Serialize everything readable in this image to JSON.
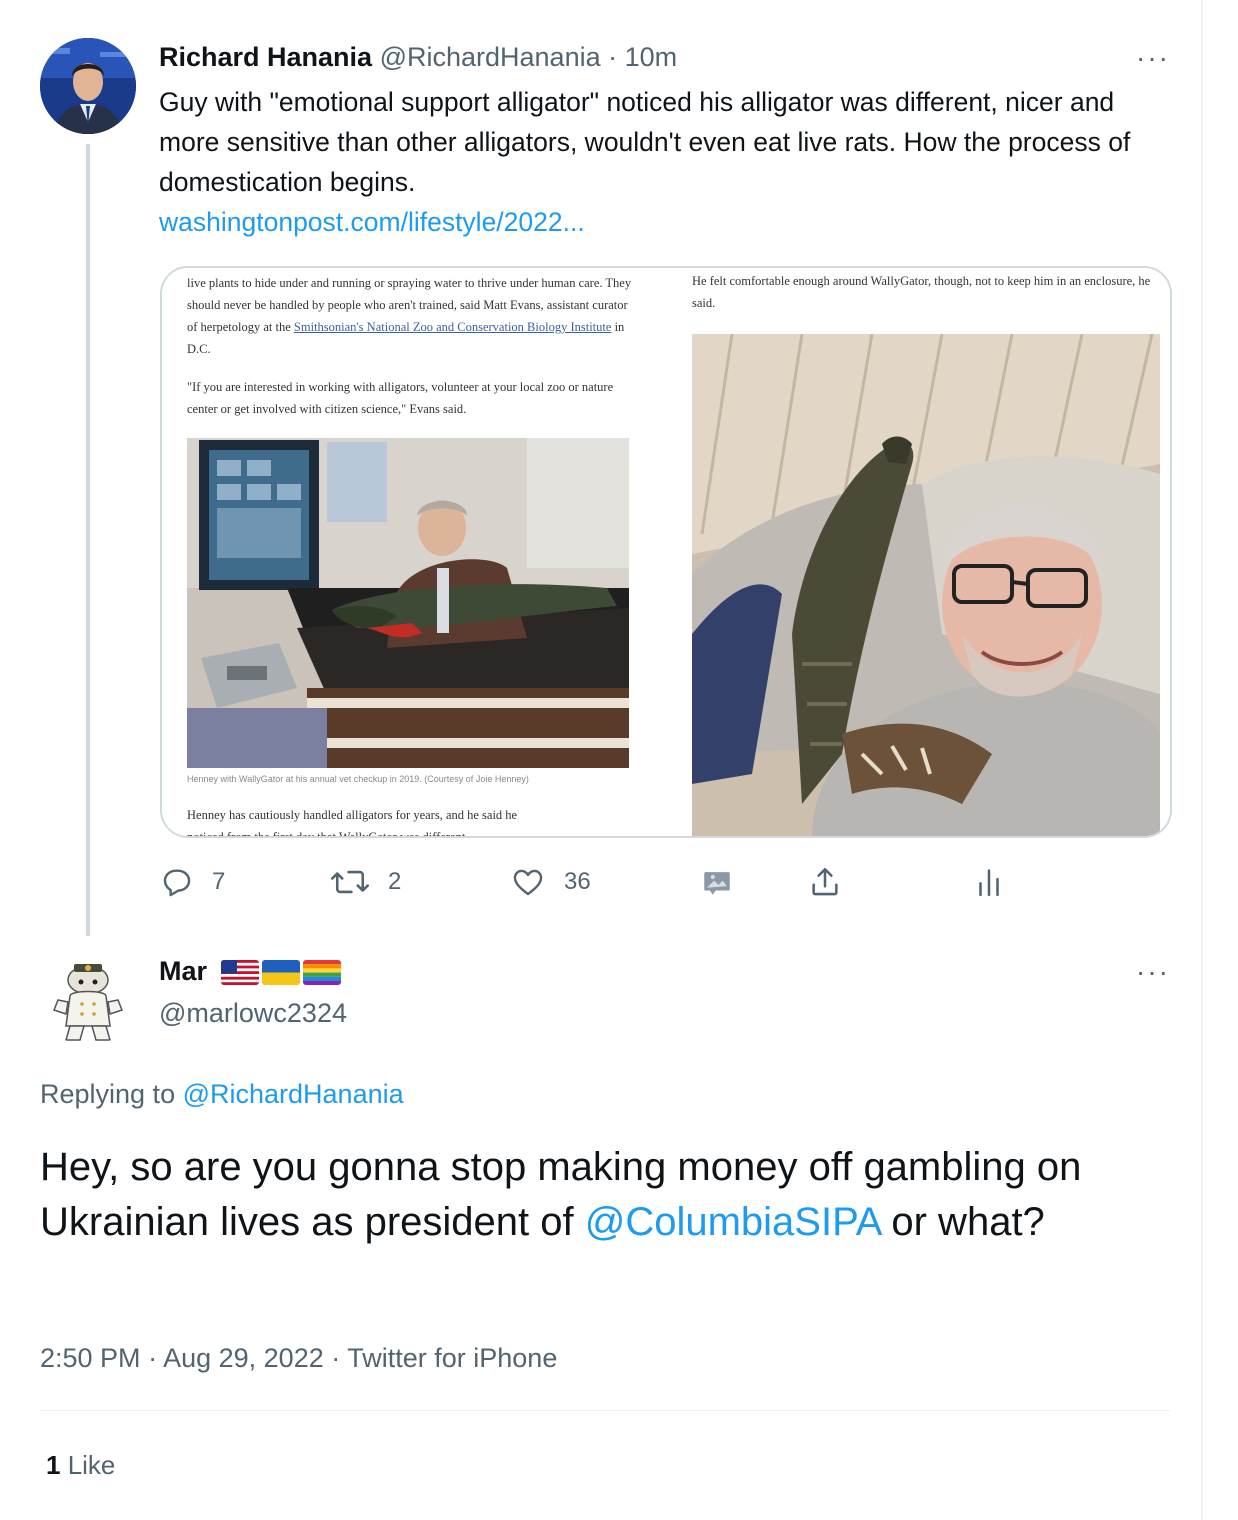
{
  "parent": {
    "name": "Richard Hanania",
    "handle": "@RichardHanania",
    "dot": "·",
    "time": "10m",
    "text": "Guy with \"emotional support alligator\" noticed his alligator was different, nicer and more sensitive than other alligators, wouldn't even eat live rats. How the process of domestication begins.",
    "link": "washingtonpost.com/lifestyle/2022...",
    "media": {
      "left_para1": "live plants to hide under and running or spraying water to thrive under human care. They should never be handled by people who aren't trained, said Matt Evans, assistant curator of herpetology at the",
      "left_para1_link": "Smithsonian's National Zoo and Conservation Biology Institute",
      "left_para1_end": " in D.C.",
      "left_para2": "\"If you are interested in working with alligators, volunteer at your local zoo or nature center or get involved with citizen science,\" Evans said.",
      "left_caption": "Henney with WallyGator at his annual vet checkup in 2019. (Courtesy of Joie Henney)",
      "left_para3": "Henney has cautiously handled alligators for years, and he said he",
      "left_para3_cut": "noticed from the first day that WallyGator was different",
      "right_para1": "He felt comfortable enough around WallyGator, though, not to keep him in an enclosure, he said."
    },
    "actions": {
      "replies": "7",
      "retweets": "2",
      "likes": "36"
    },
    "more": "···"
  },
  "reply": {
    "name": "Mar",
    "handle": "@marlowc2324",
    "more": "···",
    "replying_prefix": "Replying to ",
    "replying_to": "@RichardHanania",
    "text_a": "Hey, so are you gonna stop making money off gambling on Ukrainian lives as president of ",
    "text_mention": "@ColumbiaSIPA",
    "text_b": " or what?",
    "time": "2:50 PM",
    "sep": " · ",
    "date": "Aug 29, 2022",
    "source": "Twitter for iPhone",
    "like_count": "1",
    "like_label": " Like"
  },
  "colors": {
    "link_blue": "#1d9bf0",
    "muted": "#536471",
    "text": "#0f1419",
    "border": "#cfd9de"
  },
  "icons": [
    "reply-icon",
    "retweet-icon",
    "like-icon",
    "media-icon",
    "share-icon",
    "analytics-icon",
    "more-icon"
  ]
}
